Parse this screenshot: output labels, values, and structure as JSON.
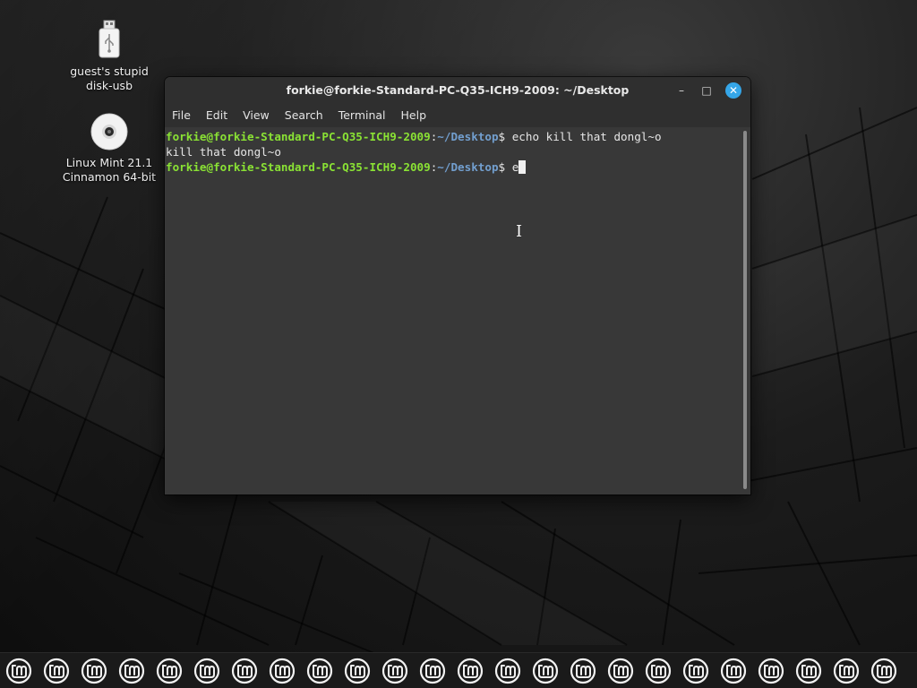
{
  "desktop": {
    "icons": [
      {
        "label_line1": "guest's stupid",
        "label_line2": "disk-usb",
        "icon": "usb-drive-icon"
      },
      {
        "label_line1": "Linux Mint 21.1",
        "label_line2": "Cinnamon 64-bit",
        "icon": "optical-disc-icon"
      }
    ]
  },
  "terminal": {
    "title": "forkie@forkie-Standard-PC-Q35-ICH9-2009: ~/Desktop",
    "menu": [
      "File",
      "Edit",
      "View",
      "Search",
      "Terminal",
      "Help"
    ],
    "lines": [
      {
        "user": "forkie@forkie-Standard-PC-Q35-ICH9-2009",
        "sep": ":",
        "path": "~/Desktop",
        "prompt": "$ ",
        "command": "echo kill that dongl~o"
      },
      {
        "output": "kill that dongl~o"
      },
      {
        "user": "forkie@forkie-Standard-PC-Q35-ICH9-2009",
        "sep": ":",
        "path": "~/Desktop",
        "prompt": "$ ",
        "command": "e"
      }
    ],
    "buttons": {
      "minimize": "–",
      "maximize": "□",
      "close": "✕"
    }
  },
  "taskbar": {
    "launcher_icon": "linux-mint-logo-icon",
    "launcher_count": 24
  },
  "colors": {
    "prompt_user": "#8ae234",
    "prompt_path": "#729fcf",
    "close_button": "#35a6e8"
  }
}
